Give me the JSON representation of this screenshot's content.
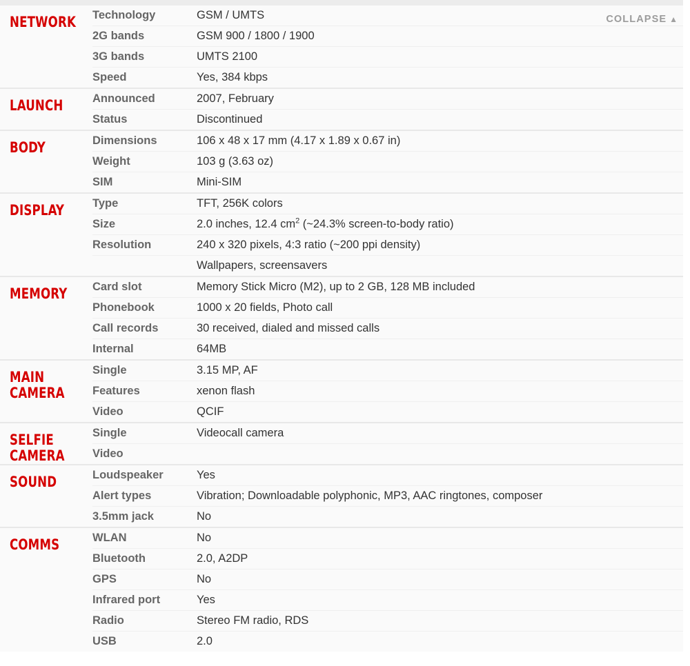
{
  "collapse": {
    "label": "COLLAPSE",
    "caret": "▲",
    "caret_icon_name": "caret-up-icon"
  },
  "colors": {
    "section_title": "#d50000",
    "label": "#666666",
    "value": "#333333",
    "background": "#fafafa",
    "row_divider": "#efefef",
    "section_divider": "#e8e8e8",
    "collapse_text": "#9b9b9b"
  },
  "sections": [
    {
      "title": "NETWORK",
      "rows": [
        {
          "label": "Technology",
          "value": "GSM / UMTS"
        },
        {
          "label": "2G bands",
          "value": "GSM 900 / 1800 / 1900"
        },
        {
          "label": "3G bands",
          "value": "UMTS 2100"
        },
        {
          "label": "Speed",
          "value": "Yes, 384 kbps"
        }
      ]
    },
    {
      "title": "LAUNCH",
      "rows": [
        {
          "label": "Announced",
          "value": "2007, February"
        },
        {
          "label": "Status",
          "value": "Discontinued"
        }
      ]
    },
    {
      "title": "BODY",
      "rows": [
        {
          "label": "Dimensions",
          "value": "106 x 48 x 17 mm (4.17 x 1.89 x 0.67 in)"
        },
        {
          "label": "Weight",
          "value": "103 g (3.63 oz)"
        },
        {
          "label": "SIM",
          "value": "Mini-SIM"
        }
      ]
    },
    {
      "title": "DISPLAY",
      "rows": [
        {
          "label": "Type",
          "value": "TFT, 256K colors"
        },
        {
          "label": "Size",
          "value_html": "2.0 inches, 12.4 cm<sup>2</sup> (~24.3% screen-to-body ratio)",
          "value": "2.0 inches, 12.4 cm2 (~24.3% screen-to-body ratio)"
        },
        {
          "label": "Resolution",
          "value": "240 x 320 pixels, 4:3 ratio (~200 ppi density)"
        },
        {
          "label": "",
          "value": "Wallpapers, screensavers"
        }
      ]
    },
    {
      "title": "MEMORY",
      "rows": [
        {
          "label": "Card slot",
          "value": "Memory Stick Micro (M2), up to 2 GB, 128 MB included"
        },
        {
          "label": "Phonebook",
          "value": "1000 x 20 fields, Photo call"
        },
        {
          "label": "Call records",
          "value": "30 received, dialed and missed calls"
        },
        {
          "label": "Internal",
          "value": "64MB"
        }
      ]
    },
    {
      "title": "MAIN\nCAMERA",
      "rows": [
        {
          "label": "Single",
          "value": "3.15 MP, AF"
        },
        {
          "label": "Features",
          "value": "xenon flash"
        },
        {
          "label": "Video",
          "value": "QCIF"
        }
      ]
    },
    {
      "title": "SELFIE\nCAMERA",
      "rows": [
        {
          "label": "Single",
          "value": "Videocall camera"
        },
        {
          "label": "Video",
          "value": ""
        }
      ]
    },
    {
      "title": "SOUND",
      "rows": [
        {
          "label": "Loudspeaker",
          "value": "Yes"
        },
        {
          "label": "Alert types",
          "value": "Vibration; Downloadable polyphonic, MP3, AAC ringtones, composer"
        },
        {
          "label": "3.5mm jack",
          "value": "No"
        }
      ]
    },
    {
      "title": "COMMS",
      "rows": [
        {
          "label": "WLAN",
          "value": "No"
        },
        {
          "label": "Bluetooth",
          "value": "2.0, A2DP"
        },
        {
          "label": "GPS",
          "value": "No"
        },
        {
          "label": "Infrared port",
          "value": "Yes"
        },
        {
          "label": "Radio",
          "value": "Stereo FM radio, RDS"
        },
        {
          "label": "USB",
          "value": "2.0"
        }
      ]
    }
  ]
}
